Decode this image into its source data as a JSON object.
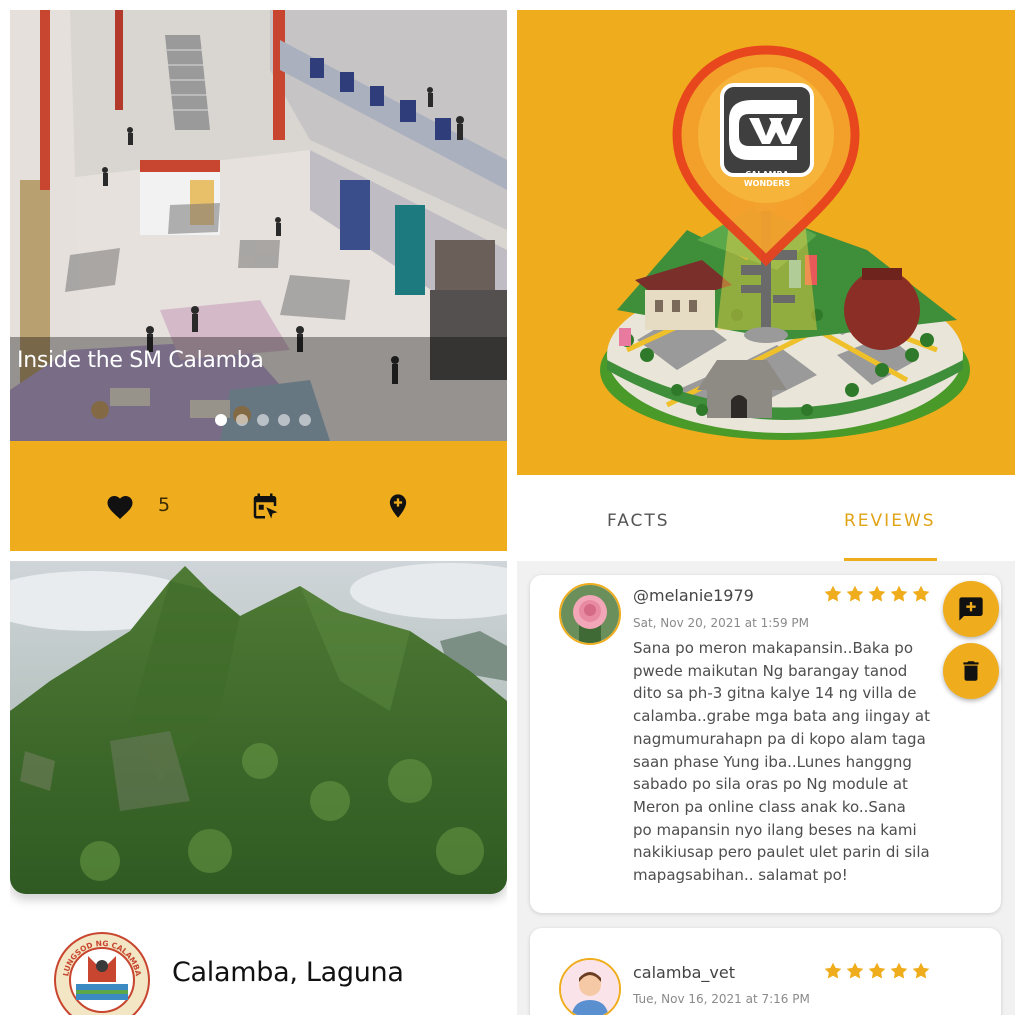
{
  "mall_card": {
    "caption": "Inside the SM Calamba",
    "carousel_slide_count": 5,
    "carousel_active_slide": 1,
    "like_count": "5",
    "icons": [
      "heart-icon",
      "calendar-icon",
      "add-location-icon"
    ],
    "accent_color": "#efad1d"
  },
  "logo_card": {
    "logo_text_top": "CALAMBA",
    "logo_text_bottom": "WONDERS"
  },
  "tabs": {
    "facts": "FACTS",
    "reviews": "REVIEWS",
    "active": "REVIEWS"
  },
  "reviews": [
    {
      "username": "@melanie1979",
      "date": "Sat,  Nov 20, 2021 at 1:59 PM",
      "rating": 5,
      "lines": [
        "Sana po meron makapansin..Baka po",
        "pwede maikutan Ng barangay tanod",
        "dito sa ph-3 gitna kalye 14 ng villa de",
        "calamba..grabe mga bata ang iingay at",
        "nagmumurahapn pa di kopo alam taga",
        "saan phase Yung iba..Lunes hanggng",
        "sabado po sila oras po Ng module at",
        "Meron pa online class anak ko..Sana",
        "po mapansin nyo ilang beses na kami",
        "nakikiusap pero paulet ulet parin di sila",
        "mapagsabihan.. salamat po!"
      ]
    },
    {
      "username": "calamba_vet",
      "date": "Tue,  Nov 16, 2021 at 7:16 PM",
      "rating": 5
    }
  ],
  "fabs": [
    "add-comment-icon",
    "trash-icon"
  ],
  "place": {
    "name": "Calamba, Laguna",
    "seal_text": "LUNGSOD NG CALAMBA"
  }
}
